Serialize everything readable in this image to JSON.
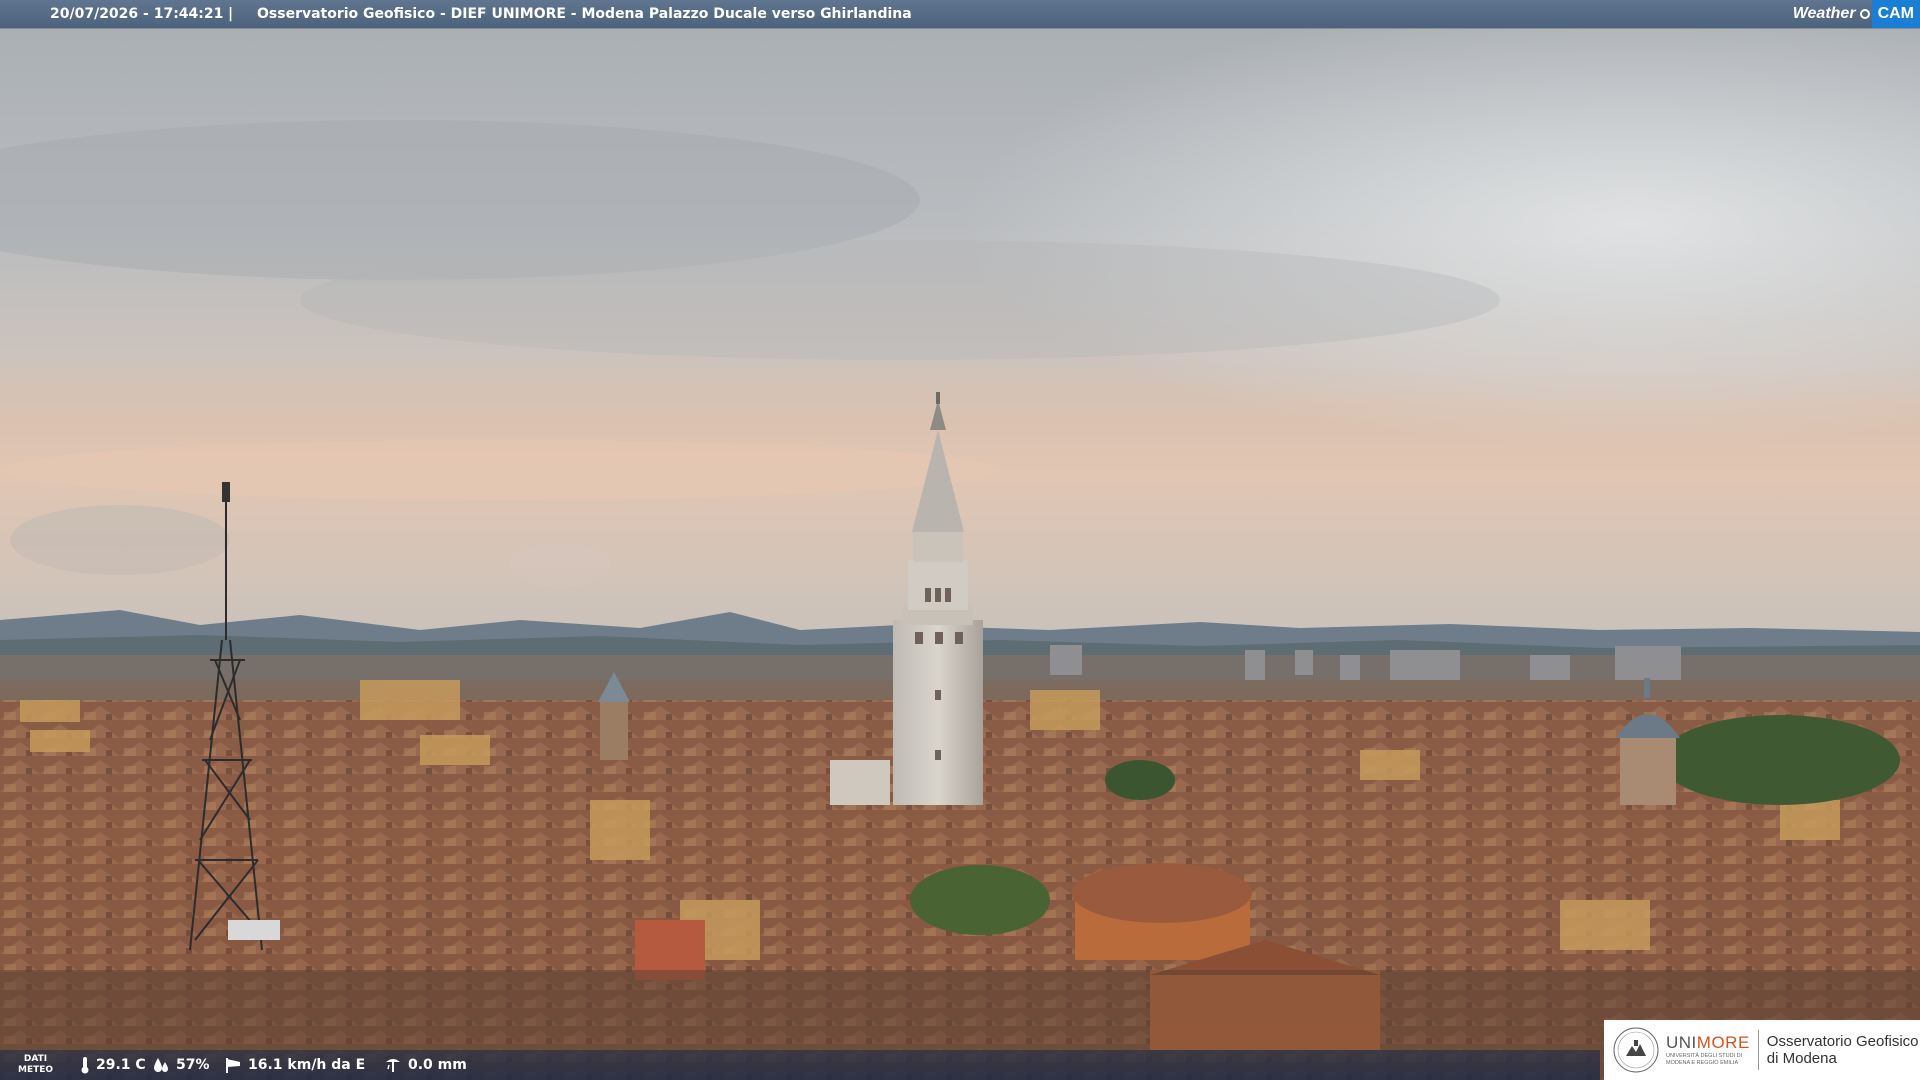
{
  "header": {
    "timestamp": "20/07/2026 - 17:44:21",
    "separator": "|",
    "camera_title": "Osservatorio Geofisico - DIEF UNIMORE - Modena Palazzo Ducale verso Ghirlandina",
    "brand_left": "Weather",
    "brand_right": "CAM"
  },
  "meteo": {
    "label_line1": "DATI",
    "label_line2": "METEO",
    "temperature": "29.1 C",
    "humidity": "57%",
    "wind": "16.1 km/h da E",
    "rain": "0.0 mm"
  },
  "logo": {
    "uni": "UNI",
    "more": "MORE",
    "sub_line1": "UNIVERSITÀ DEGLI STUDI DI",
    "sub_line2": "MODENA E REGGIO EMILIA",
    "obs_line1": "Osservatorio Geofisico",
    "obs_line2": "di Modena"
  },
  "icons": {
    "temperature": "thermometer-icon",
    "humidity": "droplets-icon",
    "wind": "wind-sock-icon",
    "rain": "rain-gauge-icon"
  },
  "colors": {
    "topbar": "#566b85",
    "brand_orange": "#d6531e",
    "weathercam_blue": "#1a7fd4"
  }
}
